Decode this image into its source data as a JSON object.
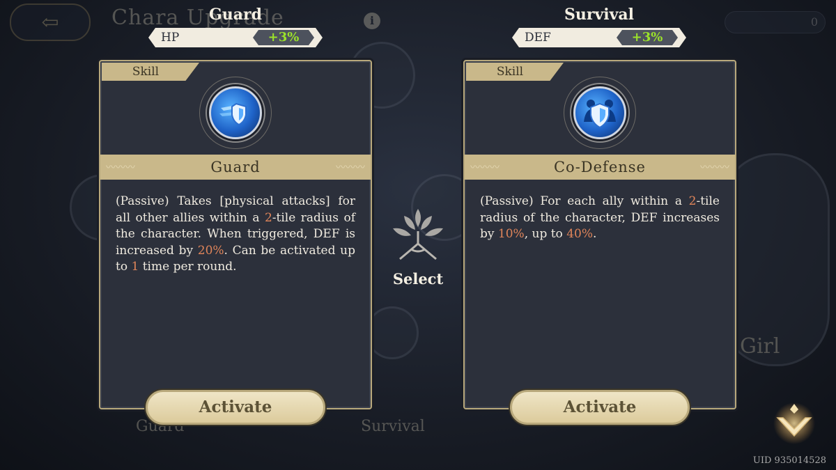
{
  "background": {
    "title": "Chara Upgrade",
    "back_icon": "back-arrow-icon",
    "bottom_left_label": "Guard",
    "bottom_right_label": "Survival",
    "girl_label": "Girl",
    "currency_value": "0"
  },
  "left": {
    "column_title": "Guard",
    "stat_name": "HP",
    "stat_value": "+3%",
    "tab_label": "Skill",
    "skill_icon": "shield-dash-icon",
    "skill_name": "Guard",
    "desc_parts": [
      "(Passive) Takes [physical attacks] for all other allies within a ",
      "2",
      "-tile radius of the character. When triggered, DEF is increased by ",
      "20%",
      ". Can be activated up to ",
      "1",
      " time per round."
    ],
    "button_label": "Activate"
  },
  "right": {
    "column_title": "Survival",
    "stat_name": "DEF",
    "stat_value": "+3%",
    "tab_label": "Skill",
    "skill_icon": "co-defense-shield-icon",
    "skill_name": "Co-Defense",
    "desc_parts": [
      "(Passive) For each ally within a ",
      "2",
      "-tile radius of the character, DEF increases by ",
      "10%",
      ", up to ",
      "40%",
      "."
    ],
    "button_label": "Activate"
  },
  "center": {
    "icon": "tree-emblem-icon",
    "label": "Select"
  },
  "chevron_icon": "chevron-down-icon",
  "uid": "UID 935014528",
  "colors": {
    "accent_gold": "#c9b88a",
    "highlight": "#e0855a",
    "stat_green": "#9be22a"
  }
}
